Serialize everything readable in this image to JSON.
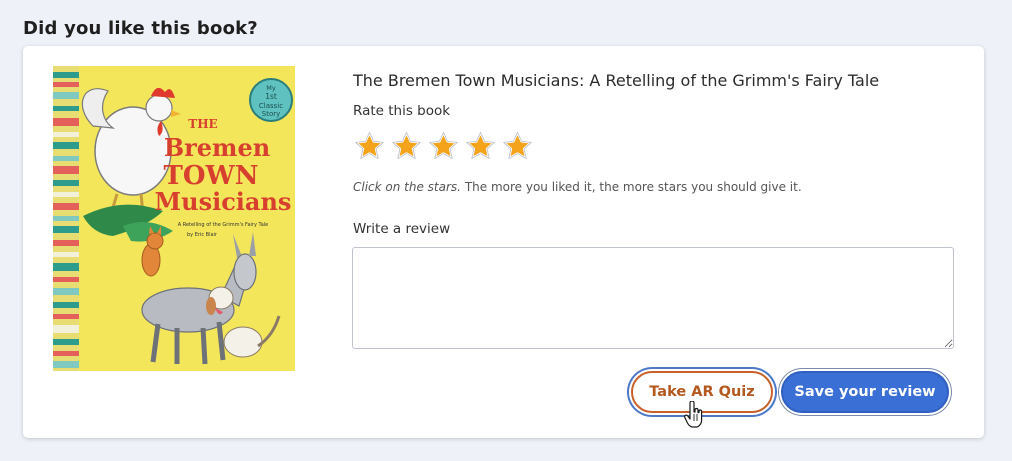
{
  "header": {
    "title": "Did you like this book?"
  },
  "book": {
    "title": "The Bremen Town Musicians: A Retelling of the Grimm's Fairy Tale",
    "cover": {
      "badge_text": [
        "My",
        "1st",
        "Classic",
        "Story"
      ],
      "title_lines": [
        "THE",
        "Bremen",
        "TOWN",
        "Musicians"
      ],
      "subtitle": "A Retelling of the Grimm's Fairy Tale",
      "author": "by Eric Blair"
    }
  },
  "rating": {
    "label": "Rate this book",
    "max_stars": 5,
    "star_color": "#f5a31a",
    "hint_emphasis": "Click on the stars.",
    "hint_rest": " The more you liked it, the more stars you should give it."
  },
  "review": {
    "label": "Write a review",
    "value": "",
    "placeholder": ""
  },
  "buttons": {
    "quiz_label": "Take AR Quiz",
    "save_label": "Save your review"
  },
  "colors": {
    "quiz_accent": "#c8612a",
    "save_blue": "#3a6fd6",
    "background": "#eef1f8"
  }
}
